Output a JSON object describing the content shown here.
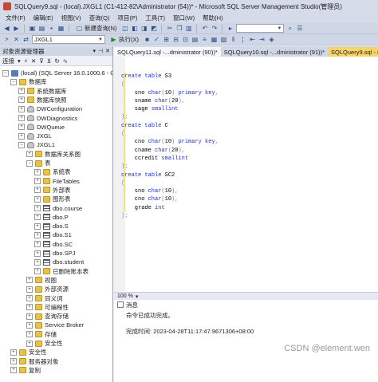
{
  "window": {
    "title": "SQLQuery9.sql - (local).JXGL1 (C1-412-82\\Administrator (54))* - Microsoft SQL Server Management Studio(管理员)"
  },
  "menu": [
    "文件(F)",
    "编辑(E)",
    "视图(V)",
    "查询(Q)",
    "项目(P)",
    "工具(T)",
    "窗口(W)",
    "帮助(H)"
  ],
  "toolbar1": {
    "new_query": "新建查询(N)"
  },
  "toolbar2": {
    "database": "JXGL1",
    "execute": "执行(X)"
  },
  "object_explorer": {
    "title": "对象资源管理器",
    "connect": "连接",
    "nodes": [
      {
        "label": "(local) (SQL Server 16.0.1000.6 - C1-412-82\\A",
        "exp": "−",
        "icon": "server",
        "level": 0
      },
      {
        "label": "数据库",
        "exp": "−",
        "icon": "folder",
        "level": 1
      },
      {
        "label": "系统数据库",
        "exp": "+",
        "icon": "folder",
        "level": 2
      },
      {
        "label": "数据库快照",
        "exp": "+",
        "icon": "folder",
        "level": 2
      },
      {
        "label": "DWConfiguration",
        "exp": "+",
        "icon": "db",
        "level": 2
      },
      {
        "label": "DWDiagnostics",
        "exp": "+",
        "icon": "db",
        "level": 2
      },
      {
        "label": "DWQueue",
        "exp": "+",
        "icon": "db",
        "level": 2
      },
      {
        "label": "JXGL",
        "exp": "+",
        "icon": "db",
        "level": 2
      },
      {
        "label": "JXGL1",
        "exp": "−",
        "icon": "db",
        "level": 2
      },
      {
        "label": "数据库关系图",
        "exp": "+",
        "icon": "folder",
        "level": 3
      },
      {
        "label": "表",
        "exp": "−",
        "icon": "folder",
        "level": 3
      },
      {
        "label": "系统表",
        "exp": "+",
        "icon": "folder",
        "level": 4
      },
      {
        "label": "FileTables",
        "exp": "+",
        "icon": "folder",
        "level": 4
      },
      {
        "label": "外部表",
        "exp": "+",
        "icon": "folder",
        "level": 4
      },
      {
        "label": "图形表",
        "exp": "+",
        "icon": "folder",
        "level": 4
      },
      {
        "label": "dbo.course",
        "exp": "+",
        "icon": "table",
        "level": 4
      },
      {
        "label": "dbo.P",
        "exp": "+",
        "icon": "table",
        "level": 4
      },
      {
        "label": "dbo.S",
        "exp": "+",
        "icon": "table",
        "level": 4
      },
      {
        "label": "dbo.S1",
        "exp": "+",
        "icon": "table",
        "level": 4
      },
      {
        "label": "dbo.SC",
        "exp": "+",
        "icon": "table",
        "level": 4
      },
      {
        "label": "dbo.SPJ",
        "exp": "+",
        "icon": "table",
        "level": 4
      },
      {
        "label": "dbo.student",
        "exp": "+",
        "icon": "table",
        "level": 4
      },
      {
        "label": "已删除账本表",
        "exp": "+",
        "icon": "folder",
        "level": 4
      },
      {
        "label": "视图",
        "exp": "+",
        "icon": "folder",
        "level": 3
      },
      {
        "label": "外部资源",
        "exp": "+",
        "icon": "folder",
        "level": 3
      },
      {
        "label": "同义词",
        "exp": "+",
        "icon": "folder",
        "level": 3
      },
      {
        "label": "可编程性",
        "exp": "+",
        "icon": "folder",
        "level": 3
      },
      {
        "label": "查询存储",
        "exp": "+",
        "icon": "folder",
        "level": 3
      },
      {
        "label": "Service Broker",
        "exp": "+",
        "icon": "folder",
        "level": 3
      },
      {
        "label": "存储",
        "exp": "+",
        "icon": "folder",
        "level": 3
      },
      {
        "label": "安全性",
        "exp": "+",
        "icon": "folder",
        "level": 3
      },
      {
        "label": "安全性",
        "exp": "+",
        "icon": "folder",
        "level": 1
      },
      {
        "label": "服务器对象",
        "exp": "+",
        "icon": "folder",
        "level": 1
      },
      {
        "label": "复制",
        "exp": "+",
        "icon": "folder",
        "level": 1
      }
    ]
  },
  "tabs": [
    {
      "label": "SQLQuery11.sql -...dministrator (90))*",
      "state": "light"
    },
    {
      "label": "SQLQuery10.sql -...dministrator (91))*",
      "state": "normal"
    },
    {
      "label": "SQLQuery9.sql - (local).JXGL1 (C1-412-82\\Administrator (54))*",
      "state": "active"
    }
  ],
  "code_lines": [
    "create table S3",
    "(",
    "    sno char(10) primary key,",
    "    sname char(20),",
    "    sage smallint",
    ");",
    "create table C",
    "(",
    "    cno char(10) primary key,",
    "    cname char(20),",
    "    ccredit smallint",
    ");",
    "create table SC2",
    "(",
    "    sno char(10),",
    "    cno char(10),",
    "    grade int",
    ");"
  ],
  "zoom": "100 %",
  "messages": {
    "tab_label": "消息",
    "lines": [
      "命令已成功完成。",
      "",
      "完成时间: 2023-04-28T11:17:47.9671306+08:00"
    ]
  },
  "watermark": "CSDN @element.wen"
}
